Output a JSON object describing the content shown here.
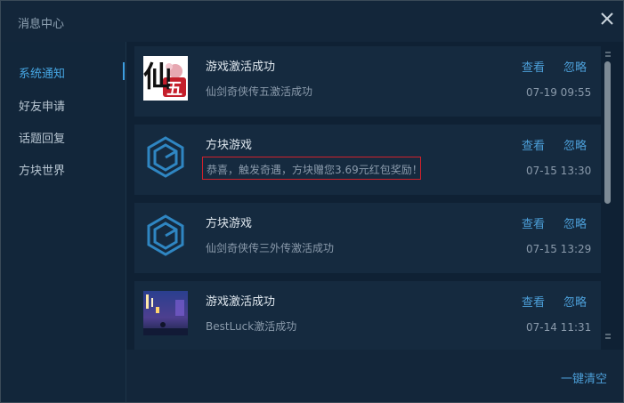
{
  "window": {
    "title": "消息中心"
  },
  "sidebar": {
    "items": [
      {
        "label": "系统通知",
        "active": true
      },
      {
        "label": "好友申请",
        "active": false
      },
      {
        "label": "话题回复",
        "active": false
      },
      {
        "label": "方块世界",
        "active": false
      }
    ]
  },
  "messages": [
    {
      "title": "游戏激活成功",
      "text": "仙剑奇侠传五激活成功",
      "time": "07-19 09:55",
      "view": "查看",
      "ignore": "忽略",
      "thumb": "xianjian-five-logo"
    },
    {
      "title": "方块游戏",
      "text": "恭喜，触发奇遇，方块赠您3.69元红包奖励！",
      "time": "07-15 13:30",
      "view": "查看",
      "ignore": "忽略",
      "thumb": "fangkuai-logo"
    },
    {
      "title": "方块游戏",
      "text": "仙剑奇侠传三外传激活成功",
      "time": "07-15 13:29",
      "view": "查看",
      "ignore": "忽略",
      "thumb": "fangkuai-logo"
    },
    {
      "title": "游戏激活成功",
      "text": "BestLuck激活成功",
      "time": "07-14 11:31",
      "view": "查看",
      "ignore": "忽略",
      "thumb": "bestluck-cover"
    }
  ],
  "footer": {
    "clear_all": "一键清空"
  },
  "logo_text": {
    "xian": "仙",
    "wu": "五"
  },
  "colors": {
    "accent": "#4c9fd8",
    "highlight_border": "#d0212b",
    "background": "#14263a"
  }
}
